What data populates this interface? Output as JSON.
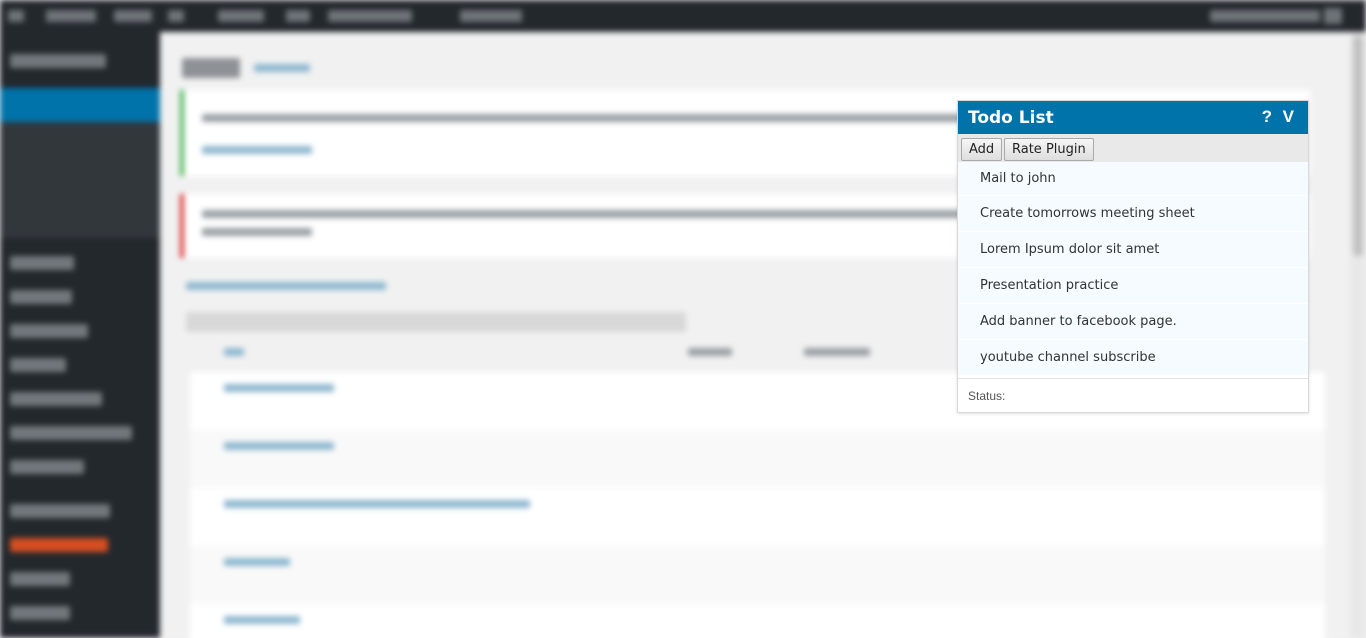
{
  "todo": {
    "title": "Todo List",
    "help_label": "?",
    "toggle_label": "V",
    "buttons": {
      "add": "Add",
      "rate": "Rate Plugin"
    },
    "items": [
      "Mail to john",
      "Create tomorrows meeting sheet",
      "Lorem Ipsum dolor sit amet",
      "Presentation practice",
      "Add banner to facebook page.",
      "youtube channel subscribe"
    ],
    "status_label": "Status:"
  },
  "colors": {
    "header": "#0073aa",
    "adminbar": "#23282d",
    "item_bg": "#f5fbfe"
  }
}
